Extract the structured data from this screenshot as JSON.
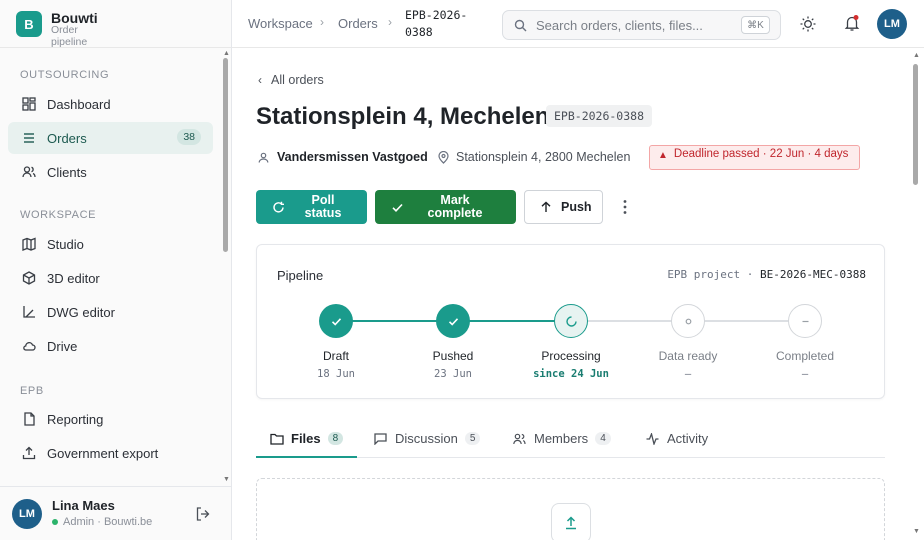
{
  "brand": {
    "logo_letter": "B",
    "name": "Bouwti",
    "subtitle": "Order pipeline"
  },
  "sidebar": {
    "sections": [
      {
        "label": "OUTSOURCING"
      },
      {
        "label": "WORKSPACE"
      },
      {
        "label": "EPB"
      }
    ],
    "items": [
      {
        "label": "Dashboard",
        "icon": "dashboard-icon"
      },
      {
        "label": "Orders",
        "icon": "list-icon",
        "badge": "38",
        "active": true
      },
      {
        "label": "Clients",
        "icon": "users-icon"
      },
      {
        "label": "Studio",
        "icon": "map-icon"
      },
      {
        "label": "3D editor",
        "icon": "cube-icon"
      },
      {
        "label": "DWG editor",
        "icon": "drafting-icon"
      },
      {
        "label": "Drive",
        "icon": "cloud-icon"
      },
      {
        "label": "Reporting",
        "icon": "report-icon"
      },
      {
        "label": "Government export",
        "icon": "export-icon"
      }
    ]
  },
  "user": {
    "initials": "LM",
    "name": "Lina Maes",
    "role": "Admin · Bouwti.be"
  },
  "topbar": {
    "breadcrumb": [
      "Workspace",
      "Orders"
    ],
    "current": "EPB-2026-0388",
    "search_placeholder": "Search orders, clients, files...",
    "shortcut": "⌘K",
    "avatar_initials": "LM"
  },
  "order": {
    "back_label": "All orders",
    "title": "Stationsplein 4, Mechelen",
    "code": "EPB-2026-0388",
    "client": "Vandersmissen Vastgoed",
    "address": "Stationsplein 4, 2800 Mechelen",
    "deadline": "Deadline passed · 22 Jun · 4 days"
  },
  "actions": {
    "poll": "Poll status",
    "complete": "Mark complete",
    "push": "Push"
  },
  "pipeline": {
    "title": "Pipeline",
    "project_label": "EPB project ·",
    "project_code": "BE-2026-MEC-0388",
    "steps": [
      {
        "label": "Draft",
        "date": "18 Jun",
        "state": "done"
      },
      {
        "label": "Pushed",
        "date": "23 Jun",
        "state": "done"
      },
      {
        "label": "Processing",
        "date": "since 24 Jun",
        "state": "processing"
      },
      {
        "label": "Data ready",
        "date": "—",
        "state": "todo"
      },
      {
        "label": "Completed",
        "date": "—",
        "state": "todo"
      }
    ]
  },
  "tabs": [
    {
      "label": "Files",
      "count": "8",
      "active": true
    },
    {
      "label": "Discussion",
      "count": "5"
    },
    {
      "label": "Members",
      "count": "4"
    },
    {
      "label": "Activity"
    }
  ],
  "colors": {
    "accent": "#1a9b8c",
    "success": "#1e7f3e",
    "danger": "#c0262d",
    "avatar": "#1e5f8a"
  }
}
